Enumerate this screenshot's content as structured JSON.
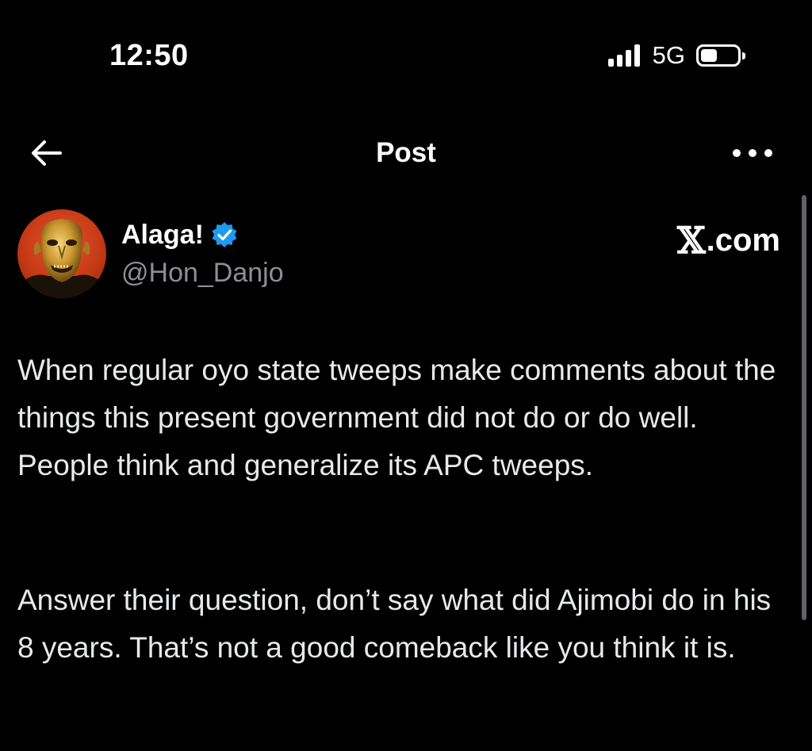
{
  "status_bar": {
    "time": "12:50",
    "network": "5G",
    "icons": [
      "signal-icon",
      "battery-icon"
    ]
  },
  "header": {
    "title": "Post",
    "back_icon": "back-arrow-icon",
    "more_icon": "more-options-icon"
  },
  "author": {
    "name": "Alaga!",
    "handle": "@Hon_Danjo",
    "verified_icon": "verified-badge-icon",
    "avatar_icon": "avatar-golden-mask"
  },
  "source": {
    "x_mark": "𝕏",
    "domain": ".com"
  },
  "post": {
    "paragraph_1": "When regular oyo state tweeps make comments about the things this present government did not do or do well. People think and generalize its APC tweeps.",
    "paragraph_2": "Answer their question, don’t say what did Ajimobi do in his 8 years. That’s not a good comeback like you think it is."
  },
  "colors": {
    "background": "#000000",
    "text": "#e7e9ea",
    "secondary_text": "#8b8f94",
    "verified_blue": "#1d9bf0",
    "avatar_bg": "#c73a16"
  }
}
